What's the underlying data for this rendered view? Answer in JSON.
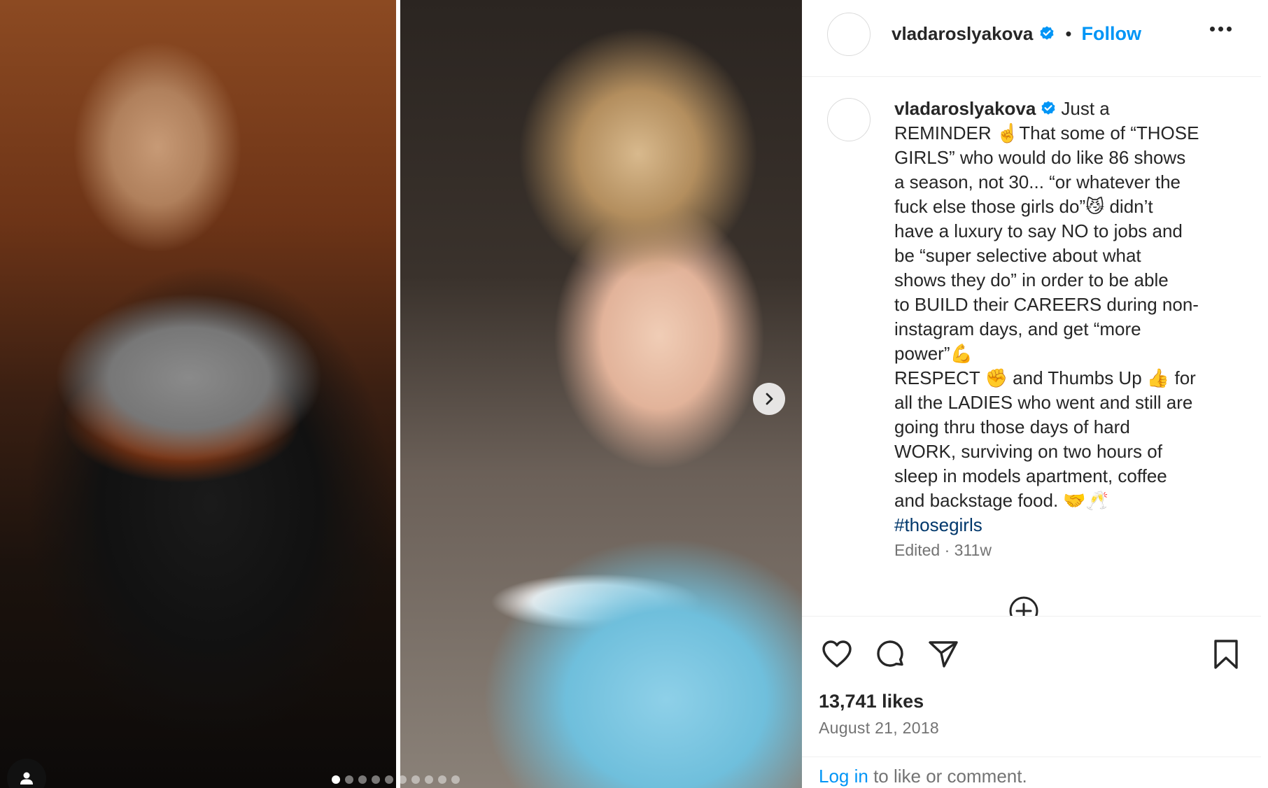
{
  "post": {
    "username": "vladaroslyakova",
    "separator": "•",
    "follow_label": "Follow",
    "caption_lines": [
      "Just a",
      "REMINDER ☝️That some of “THOSE",
      "GIRLS” who would do like 86 shows",
      "a season, not 30... “or whatever the",
      "fuck else those girls do”😼 didn’t",
      "have a luxury to say NO to jobs and",
      "be “super selective about what",
      "shows they do” in order to be able",
      "to BUILD their CAREERS during non-",
      "instagram days, and get “more",
      "power”💪",
      "RESPECT ✊ and Thumbs Up 👍 for",
      "all the LADIES who went and still are",
      "going thru those days of hard",
      "WORK, surviving on two hours of",
      "sleep in models apartment, coffee",
      "and backstage food. 🤝🥂"
    ],
    "hashtag": "#thosegirls",
    "edited_time": "Edited · 311w",
    "likes": "13,741 likes",
    "date": "August 21, 2018",
    "login_link": "Log in",
    "login_rest": " to like or comment.",
    "carousel": {
      "total_slides": 10,
      "active_slide": 1
    },
    "icons": {
      "verified": "verified-badge-icon",
      "more": "more-options-icon",
      "next": "chevron-right-icon",
      "like": "heart-icon",
      "comment": "comment-icon",
      "share": "share-icon",
      "save": "bookmark-icon",
      "load_more": "plus-circle-icon",
      "tag": "user-tag-icon"
    },
    "colors": {
      "accent": "#0095f6",
      "verified": "#0095f6",
      "hashtag": "#00376b",
      "muted": "#737373",
      "text": "#262626"
    }
  }
}
